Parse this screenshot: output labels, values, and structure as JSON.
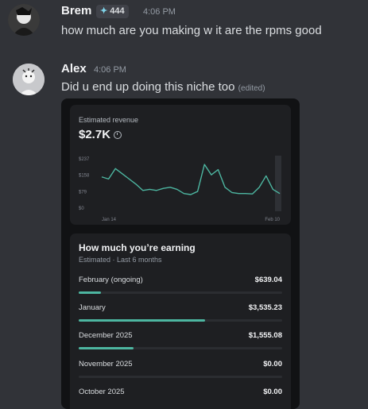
{
  "messages": [
    {
      "author": "Brem",
      "badge": "444",
      "time": "4:06 PM",
      "text": "how much are you making w it are the rpms good"
    },
    {
      "author": "Alex",
      "time": "4:06 PM",
      "text": "Did u end up doing this niche too",
      "edited": "(edited)"
    }
  ],
  "revenue": {
    "label": "Estimated revenue",
    "value": "$2.7K"
  },
  "chart_data": {
    "type": "line",
    "y_ticks": [
      "$237",
      "$158",
      "$79",
      "$0"
    ],
    "ylim": [
      0,
      237
    ],
    "x_tick_labels": [
      "Jan 14",
      "Feb 10"
    ],
    "values": [
      150,
      140,
      190,
      165,
      140,
      115,
      85,
      90,
      85,
      95,
      100,
      90,
      70,
      65,
      80,
      210,
      160,
      185,
      100,
      75,
      70,
      70,
      68,
      100,
      155,
      90,
      70
    ],
    "line_color": "#4db6a1"
  },
  "earnings": {
    "title": "How much you’re earning",
    "subtitle": "Estimated · Last 6 months",
    "rows": [
      {
        "label": "February (ongoing)",
        "amount": "$639.04",
        "fraction": 0.11
      },
      {
        "label": "January",
        "amount": "$3,535.23",
        "fraction": 0.62
      },
      {
        "label": "December 2025",
        "amount": "$1,555.08",
        "fraction": 0.27
      },
      {
        "label": "November 2025",
        "amount": "$0.00",
        "fraction": 0
      },
      {
        "label": "October 2025",
        "amount": "$0.00",
        "fraction": 0
      }
    ]
  }
}
